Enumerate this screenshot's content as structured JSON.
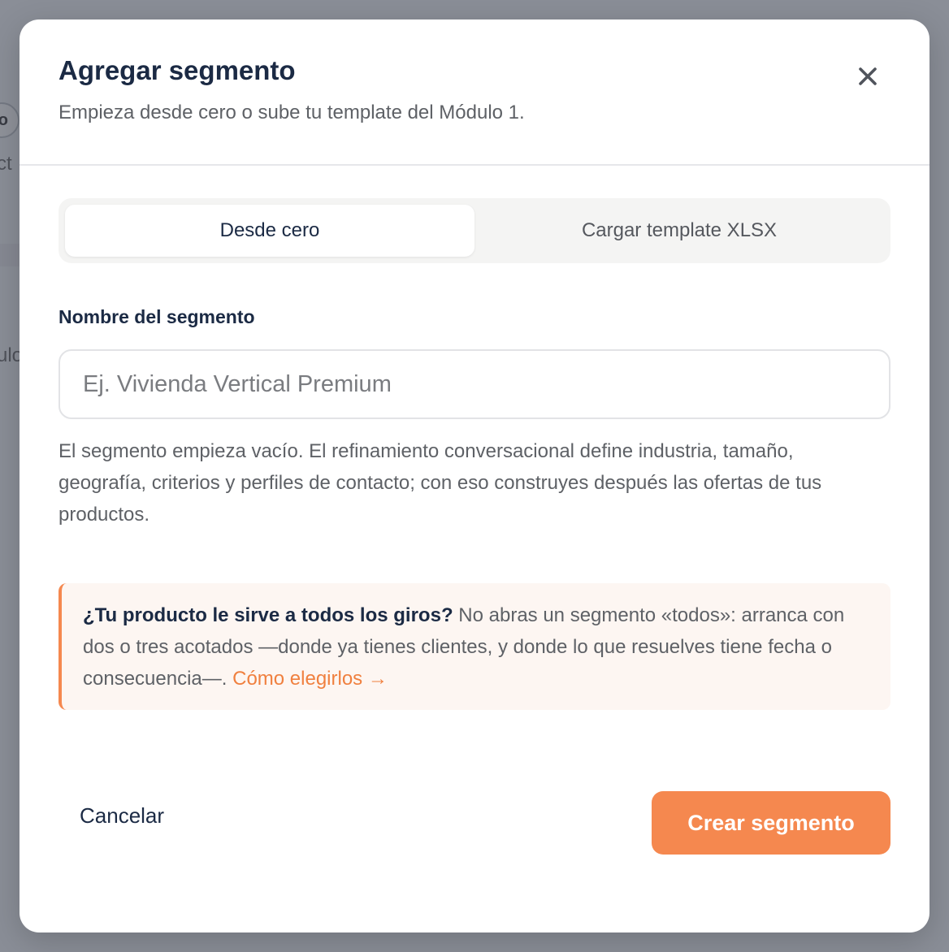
{
  "background": {
    "pill_text": "o",
    "text_1": "ct",
    "text_2": "ulo"
  },
  "modal": {
    "title": "Agregar segmento",
    "subtitle": "Empieza desde cero o sube tu template del Módulo 1.",
    "close_icon": "close-icon"
  },
  "tabs": [
    {
      "label": "Desde cero",
      "active": true
    },
    {
      "label": "Cargar template XLSX",
      "active": false
    }
  ],
  "form": {
    "name_label": "Nombre del segmento",
    "name_value": "",
    "name_placeholder": "Ej. Vivienda Vertical Premium",
    "help_text": "El segmento empieza vacío. El refinamiento conversacional define industria, tamaño, geografía, criterios y perfiles de contacto; con eso construyes después las ofertas de tus productos."
  },
  "callout": {
    "bold": "¿Tu producto le sirve a todos los giros?",
    "text": " No abras un segmento «todos»: arranca con dos o tres acotados —donde ya tienes clientes, y donde lo que resuelves tiene fecha o consecuencia—. ",
    "link": "Cómo elegirlos →"
  },
  "footer": {
    "cancel_label": "Cancelar",
    "create_label": "Crear segmento"
  },
  "colors": {
    "accent": "#f5884f",
    "title": "#1b2a44",
    "callout_bg": "#fdf6f2"
  }
}
